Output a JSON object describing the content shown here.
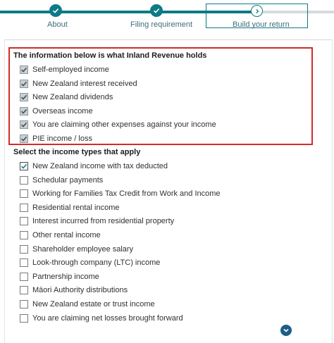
{
  "stepper": {
    "steps": [
      {
        "label": "About",
        "status": "done"
      },
      {
        "label": "Filing requirement",
        "status": "done"
      },
      {
        "label": "Build your return",
        "status": "current"
      }
    ]
  },
  "ir_section": {
    "title": "The information below is what Inland Revenue holds",
    "items": [
      {
        "label": "Self-employed income",
        "checked": true
      },
      {
        "label": "New Zealand interest received",
        "checked": true
      },
      {
        "label": "New Zealand dividends",
        "checked": true
      },
      {
        "label": "Overseas income",
        "checked": true
      },
      {
        "label": "You are claiming other expenses against your income",
        "checked": true
      },
      {
        "label": "PIE income / loss",
        "checked": true
      }
    ]
  },
  "income_section": {
    "title": "Select the income types that apply",
    "items": [
      {
        "label": "New Zealand income with tax deducted",
        "checked": true
      },
      {
        "label": "Schedular payments",
        "checked": false
      },
      {
        "label": "Working for Families Tax Credit from Work and Income",
        "checked": false
      },
      {
        "label": "Residential rental income",
        "checked": false
      },
      {
        "label": "Interest incurred from residential property",
        "checked": false
      },
      {
        "label": "Other rental income",
        "checked": false
      },
      {
        "label": "Shareholder employee salary",
        "checked": false
      },
      {
        "label": "Look-through company (LTC) income",
        "checked": false
      },
      {
        "label": "Partnership income",
        "checked": false
      },
      {
        "label": "Māori Authority distributions",
        "checked": false
      },
      {
        "label": "New Zealand estate or trust income",
        "checked": false
      },
      {
        "label": "You are claiming net losses brought forward",
        "checked": false
      }
    ]
  },
  "colors": {
    "accent": "#0d7a86",
    "highlight_border": "#d22a2a",
    "scroll_button": "#1c5f88"
  }
}
